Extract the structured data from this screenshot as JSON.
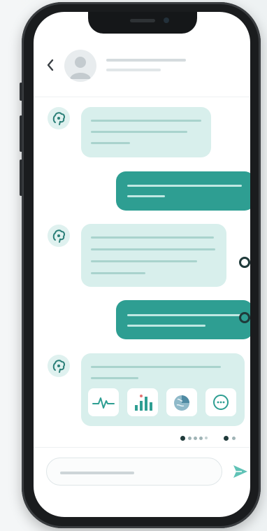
{
  "app": {
    "accent_color": "#2e9e92",
    "incoming_bubble_color": "#d8efec"
  },
  "header": {
    "back_icon": "chevron-left-icon",
    "avatar_icon": "user-avatar-icon"
  },
  "messages": [
    {
      "sender": "bot",
      "icon": "brain-bot-icon",
      "text_lines": 3
    },
    {
      "sender": "user",
      "text_lines": 2
    },
    {
      "sender": "bot",
      "icon": "brain-bot-icon",
      "text_lines": 4
    },
    {
      "sender": "user",
      "text_lines": 2
    },
    {
      "sender": "bot",
      "icon": "brain-bot-icon",
      "text_lines": 1,
      "attachments": [
        "heartbeat-icon",
        "bar-chart-icon",
        "brain-scan-icon",
        "more-circle-icon"
      ]
    }
  ],
  "pagination": {
    "total": 7,
    "active": [
      0,
      5
    ]
  },
  "composer": {
    "send_icon": "send-icon"
  }
}
